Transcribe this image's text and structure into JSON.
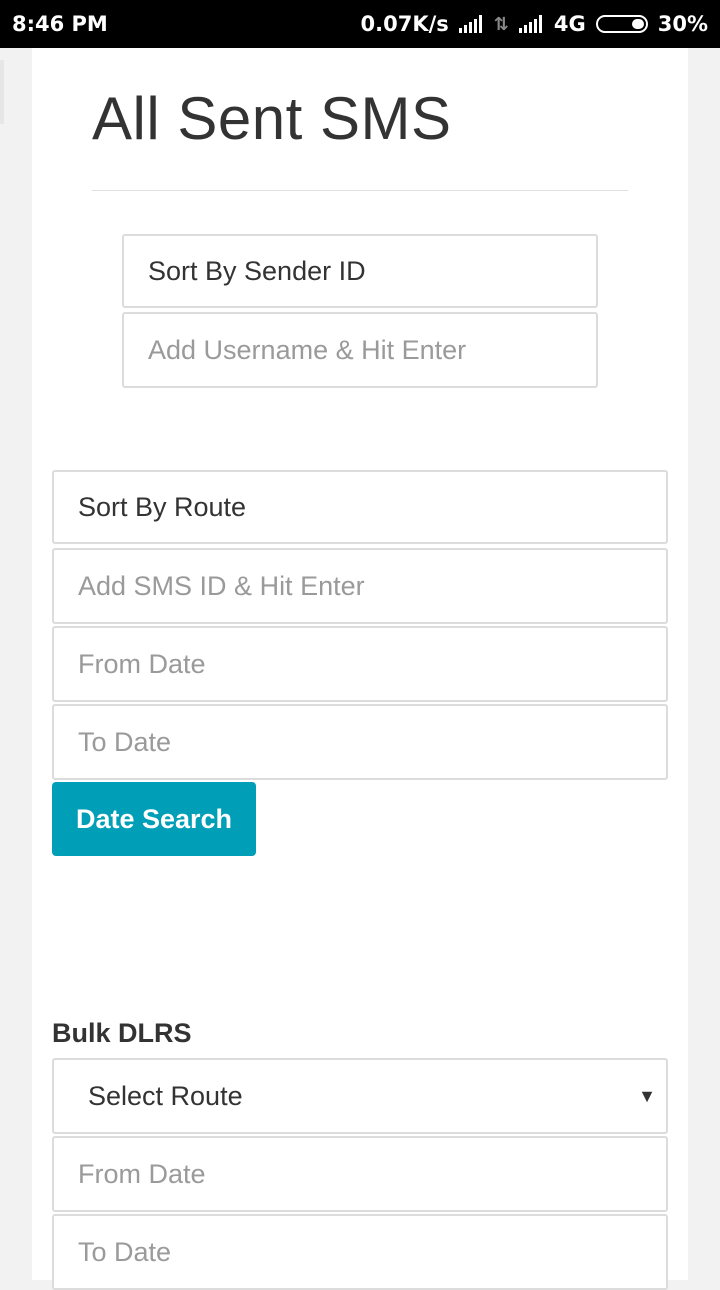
{
  "status": {
    "time": "8:46 PM",
    "speed": "0.07K/s",
    "network": "4G",
    "battery": "30%"
  },
  "page": {
    "title": "All Sent SMS"
  },
  "filters": {
    "sender_sort": "Sort By Sender ID",
    "username_placeholder": "Add Username & Hit Enter",
    "route_sort": "Sort By Route",
    "sms_id_placeholder": "Add SMS ID & Hit Enter",
    "from_date_placeholder": "From Date",
    "to_date_placeholder": "To Date",
    "search_button": "Date Search"
  },
  "bulk": {
    "label": "Bulk DLRS",
    "route_select": "Select Route",
    "from_date_placeholder": "From Date",
    "to_date_placeholder": "To Date"
  },
  "colors": {
    "accent": "#009fb7",
    "statusbar": "#000000"
  }
}
